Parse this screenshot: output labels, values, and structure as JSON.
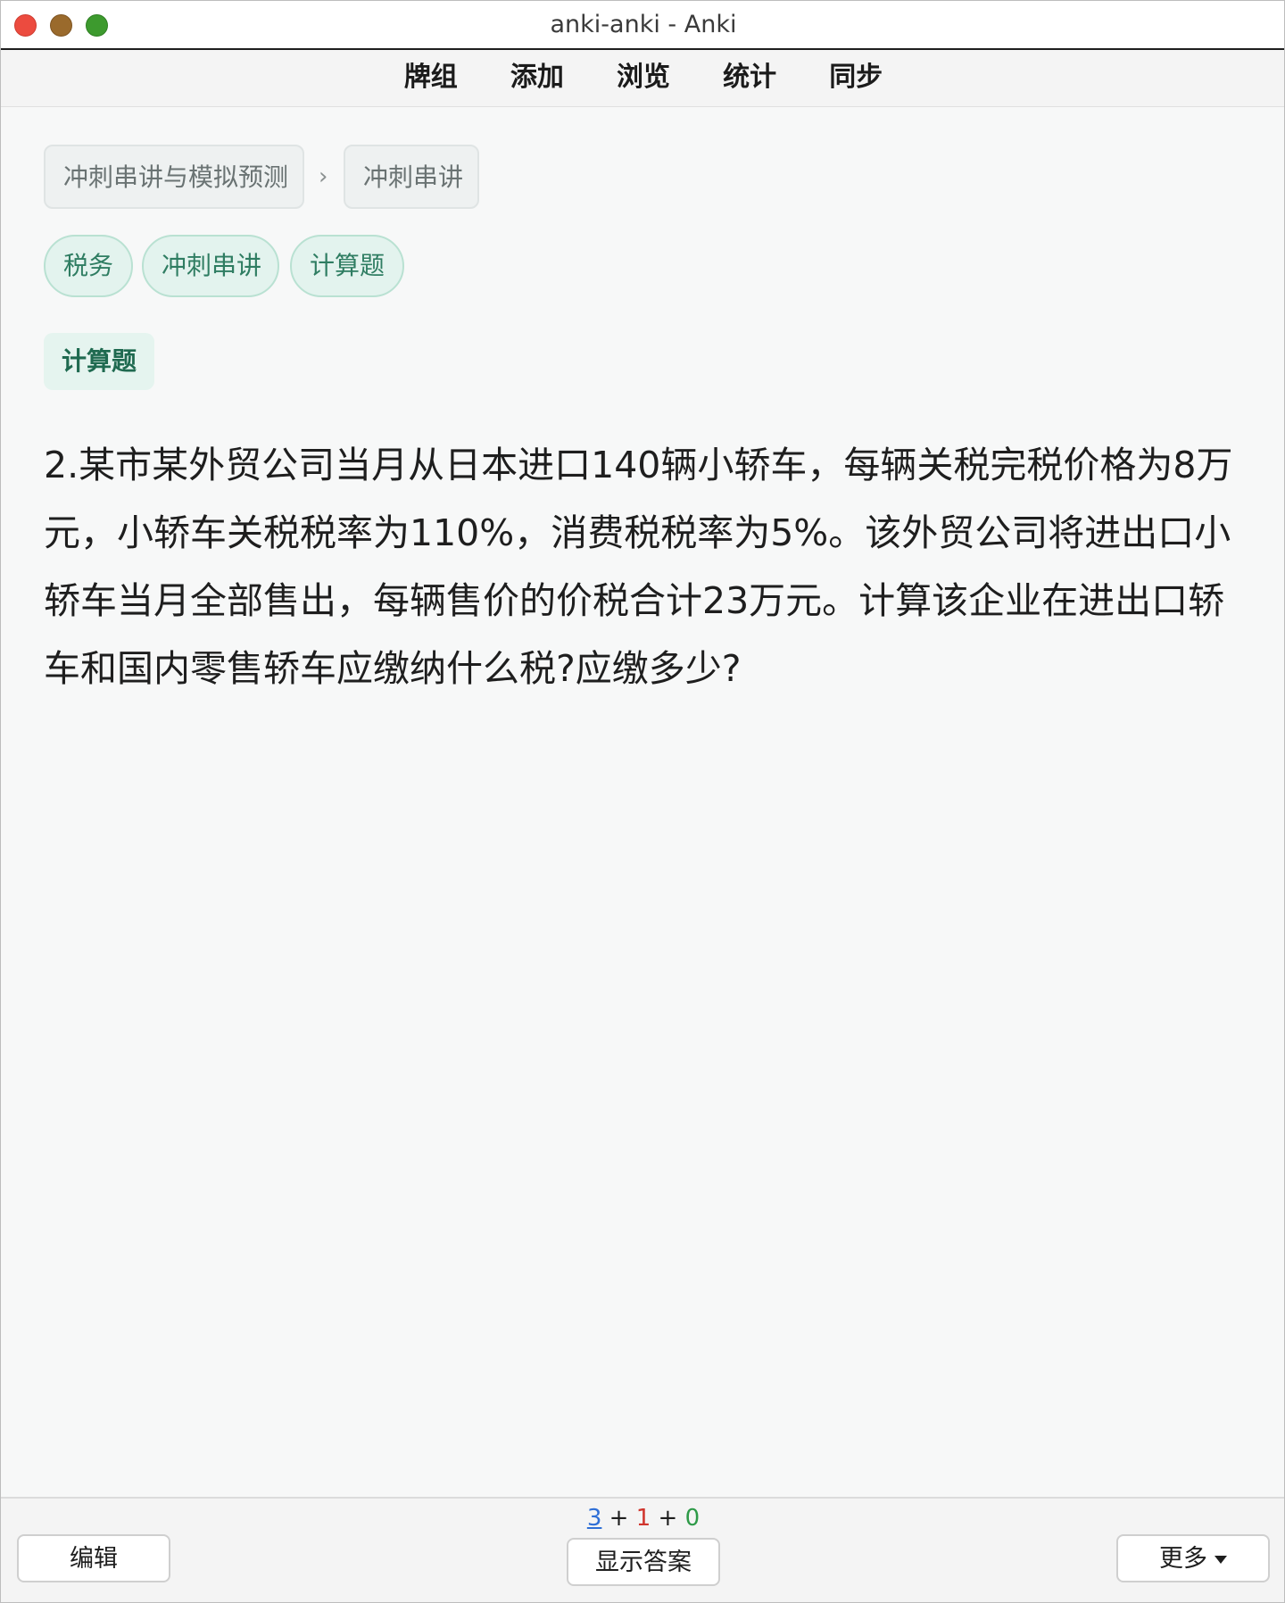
{
  "window": {
    "title": "anki-anki - Anki"
  },
  "toolbar": {
    "items": [
      "牌组",
      "添加",
      "浏览",
      "统计",
      "同步"
    ]
  },
  "card": {
    "breadcrumbs": [
      "冲刺串讲与模拟预测",
      "冲刺串讲"
    ],
    "breadcrumb_separator": "›",
    "tags": [
      "税务",
      "冲刺串讲",
      "计算题"
    ],
    "type_label": "计算题",
    "question": "2.某市某外贸公司当月从日本进口140辆小轿车，每辆关税完税价格为8万元，小轿车关税税率为110%，消费税税率为5%。该外贸公司将进出口小轿车当月全部售出，每辆售价的价税合计23万元。计算该企业在进出口轿车和国内零售轿车应缴纳什么税?应缴多少?"
  },
  "bottombar": {
    "edit_label": "编辑",
    "show_answer_label": "显示答案",
    "more_label": "更多",
    "counts": {
      "new": "3",
      "learn": "1",
      "review": "0",
      "plus": "+"
    }
  },
  "colors": {
    "new_count": "#2f6fd6",
    "learn_count": "#d0342c",
    "review_count": "#2e9a48",
    "tag_text": "#2f7d62",
    "tag_bg": "#e3f3ee"
  }
}
